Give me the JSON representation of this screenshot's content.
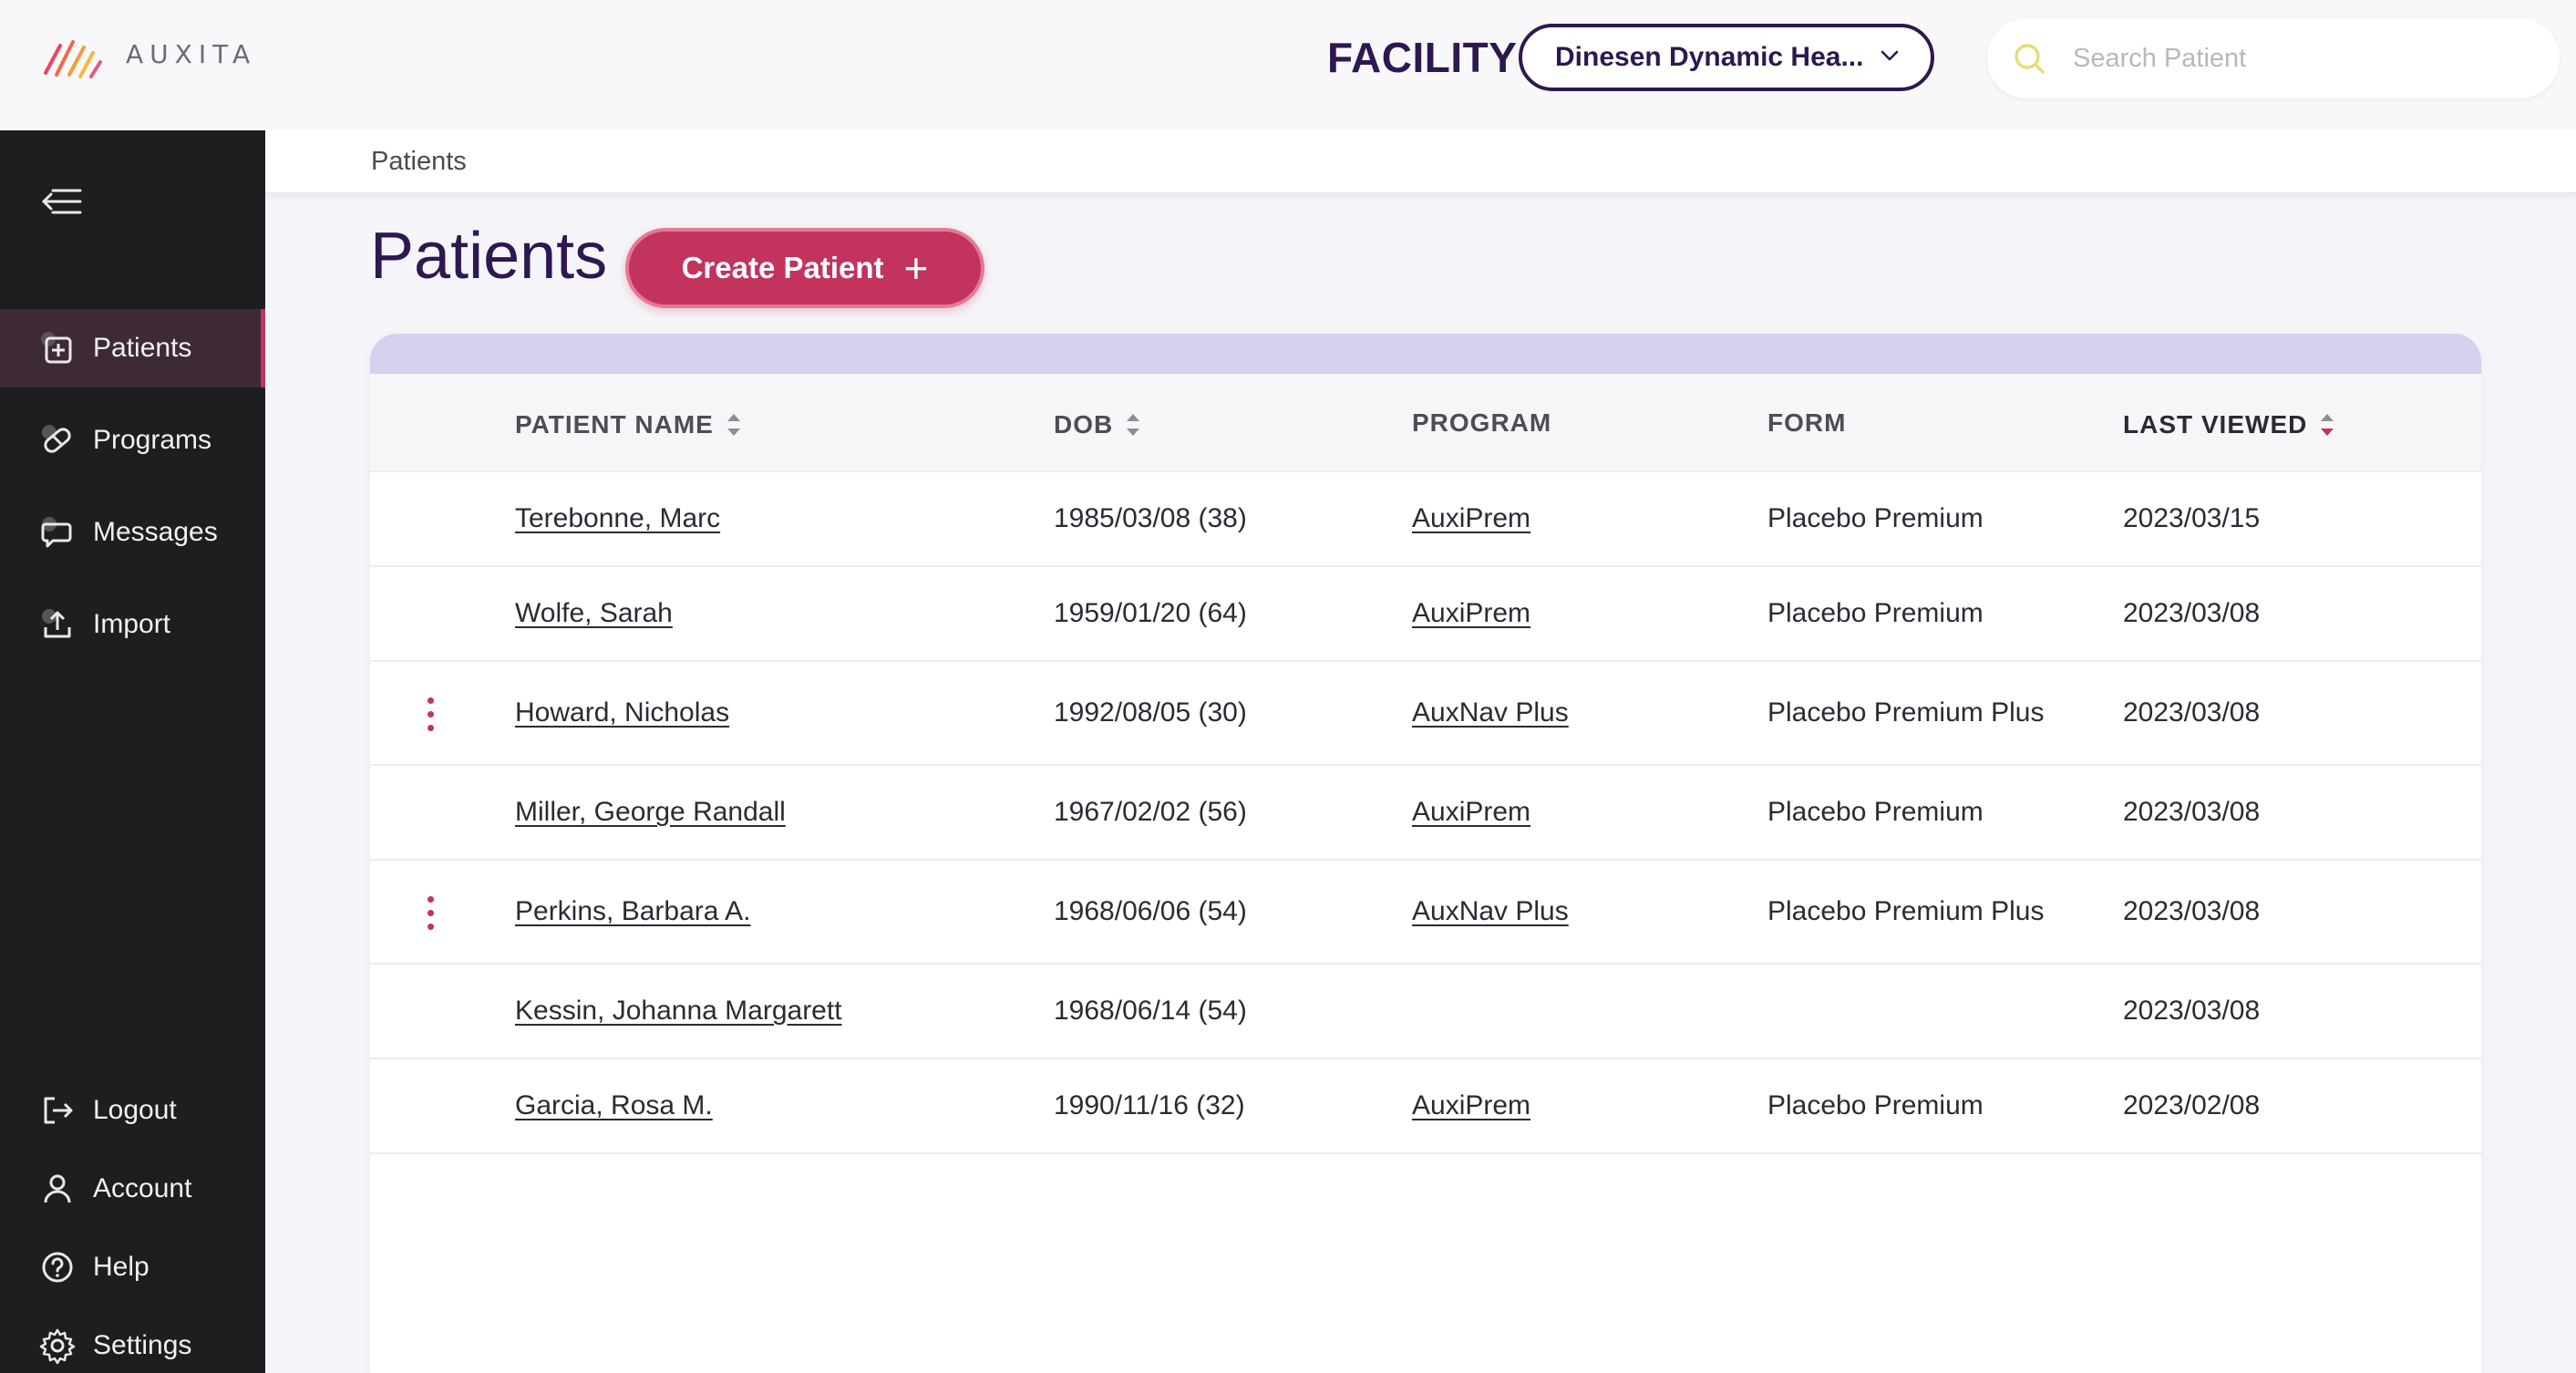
{
  "brand": {
    "name": "AUXITA"
  },
  "header": {
    "facility_label": "FACILITY",
    "facility_value": "Dinesen Dynamic Hea...",
    "search_placeholder": "Search Patient"
  },
  "sidebar": {
    "items": [
      {
        "label": "Patients",
        "icon": "patient-folder-icon",
        "active": true
      },
      {
        "label": "Programs",
        "icon": "pill-icon"
      },
      {
        "label": "Messages",
        "icon": "chat-icon"
      },
      {
        "label": "Import",
        "icon": "upload-icon"
      }
    ],
    "bottom_items": [
      {
        "label": "Logout",
        "icon": "logout-icon"
      },
      {
        "label": "Account",
        "icon": "user-icon"
      },
      {
        "label": "Help",
        "icon": "help-icon"
      },
      {
        "label": "Settings",
        "icon": "gear-icon"
      }
    ]
  },
  "breadcrumb": "Patients",
  "page": {
    "title": "Patients",
    "create_button": "Create Patient"
  },
  "table": {
    "columns": [
      "PATIENT NAME",
      "DOB",
      "PROGRAM",
      "FORM",
      "LAST VIEWED"
    ],
    "rows": [
      {
        "name": "Terebonne, Marc",
        "dob": "1985/03/08 (38)",
        "program": "AuxiPrem",
        "form": "Placebo Premium",
        "last_viewed": "2023/03/15",
        "menu": false
      },
      {
        "name": "Wolfe, Sarah",
        "dob": "1959/01/20 (64)",
        "program": "AuxiPrem",
        "form": "Placebo Premium",
        "last_viewed": "2023/03/08",
        "menu": false
      },
      {
        "name": "Howard, Nicholas",
        "dob": "1992/08/05 (30)",
        "program": "AuxNav Plus",
        "form": "Placebo Premium Plus",
        "last_viewed": "2023/03/08",
        "menu": true
      },
      {
        "name": "Miller, George Randall",
        "dob": "1967/02/02 (56)",
        "program": "AuxiPrem",
        "form": "Placebo Premium",
        "last_viewed": "2023/03/08",
        "menu": false
      },
      {
        "name": "Perkins, Barbara A.",
        "dob": "1968/06/06 (54)",
        "program": "AuxNav Plus",
        "form": "Placebo Premium Plus",
        "last_viewed": "2023/03/08",
        "menu": true
      },
      {
        "name": "Kessin, Johanna Margarett",
        "dob": "1968/06/14 (54)",
        "program": "",
        "form": "",
        "last_viewed": "2023/03/08",
        "menu": false
      },
      {
        "name": "Garcia, Rosa M.",
        "dob": "1990/11/16 (32)",
        "program": "AuxiPrem",
        "form": "Placebo Premium",
        "last_viewed": "2023/02/08",
        "menu": false
      }
    ]
  },
  "colors": {
    "accent": "#c2335d",
    "brand_purple": "#2e1850",
    "sidebar_bg": "#1e1e21",
    "band": "#d4d0ee"
  }
}
